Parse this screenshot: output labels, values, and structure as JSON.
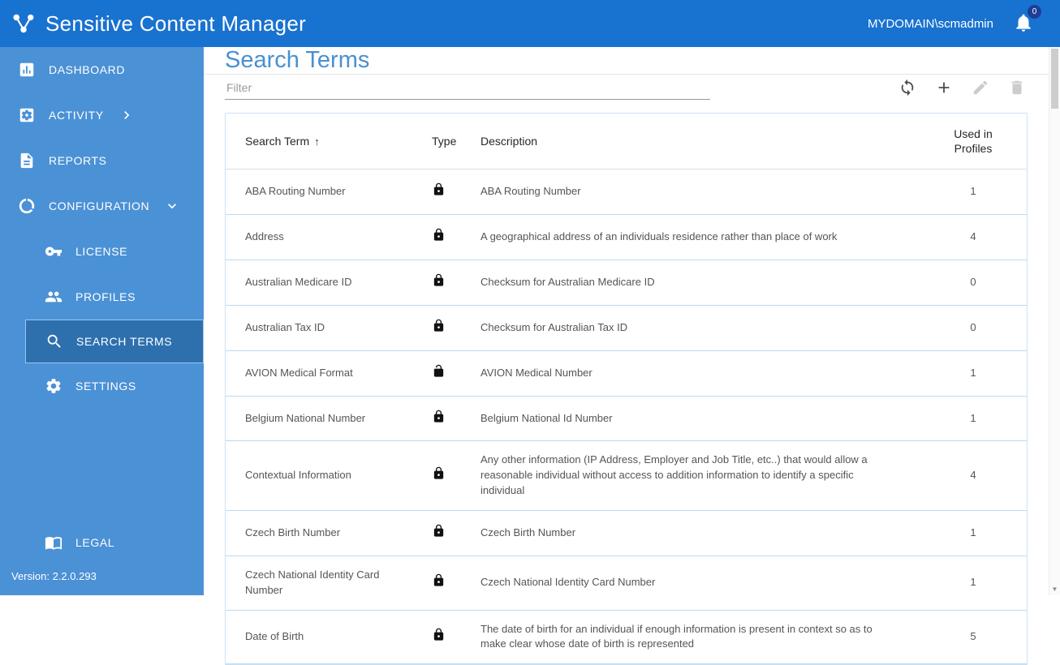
{
  "header": {
    "app_title": "Sensitive Content Manager",
    "username": "MYDOMAIN\\scmadmin",
    "notification_badge": "0"
  },
  "sidebar": {
    "items": [
      {
        "label": "DASHBOARD",
        "icon": "dashboard-icon"
      },
      {
        "label": "ACTIVITY",
        "icon": "activity-icon",
        "chevron": "right"
      },
      {
        "label": "REPORTS",
        "icon": "reports-icon"
      },
      {
        "label": "CONFIGURATION",
        "icon": "configuration-icon",
        "chevron": "down"
      },
      {
        "label": "LICENSE",
        "icon": "license-icon"
      },
      {
        "label": "PROFILES",
        "icon": "profiles-icon"
      },
      {
        "label": "SEARCH TERMS",
        "icon": "search-icon",
        "selected": true
      },
      {
        "label": "SETTINGS",
        "icon": "settings-icon"
      },
      {
        "label": "LEGAL",
        "icon": "legal-icon"
      }
    ],
    "version": "Version: 2.2.0.293"
  },
  "main": {
    "page_title": "Search Terms",
    "filter": {
      "placeholder": "Filter"
    },
    "toolbar": {
      "buttons": [
        {
          "name": "refresh",
          "icon": "refresh-icon",
          "enabled": true
        },
        {
          "name": "add",
          "icon": "add-icon",
          "enabled": true
        },
        {
          "name": "edit",
          "icon": "edit-icon",
          "enabled": false
        },
        {
          "name": "delete",
          "icon": "delete-icon",
          "enabled": false
        }
      ]
    },
    "table": {
      "columns": {
        "term": "Search Term",
        "sort_indicator": "↑",
        "type": "Type",
        "description": "Description",
        "used": "Used in Profiles"
      },
      "rows": [
        {
          "term": "ABA Routing Number",
          "type": "locked",
          "description": "ABA Routing Number",
          "used_in_profiles": "1"
        },
        {
          "term": "Address",
          "type": "locked",
          "description": "A geographical address of an individuals residence rather than place of work",
          "used_in_profiles": "4"
        },
        {
          "term": "Australian Medicare ID",
          "type": "locked",
          "description": "Checksum for Australian Medicare ID",
          "used_in_profiles": "0"
        },
        {
          "term": "Australian Tax ID",
          "type": "locked",
          "description": "Checksum for Australian Tax ID",
          "used_in_profiles": "0"
        },
        {
          "term": "AVION Medical Format",
          "type": "unlocked",
          "description": "AVION Medical Number",
          "used_in_profiles": "1"
        },
        {
          "term": "Belgium National Number",
          "type": "locked",
          "description": "Belgium National Id Number",
          "used_in_profiles": "1"
        },
        {
          "term": "Contextual Information",
          "type": "locked",
          "description": "Any other information (IP Address, Employer and Job Title, etc..) that would allow a reasonable individual without access to addition information to identify a specific individual",
          "used_in_profiles": "4"
        },
        {
          "term": "Czech Birth Number",
          "type": "locked",
          "description": "Czech Birth Number",
          "used_in_profiles": "1"
        },
        {
          "term": "Czech National Identity Card Number",
          "type": "locked",
          "description": "Czech National Identity Card Number",
          "used_in_profiles": "1"
        },
        {
          "term": "Date of Birth",
          "type": "locked",
          "description": "The date of birth for an individual if enough information is present in context so as to make clear whose date of birth is represented",
          "used_in_profiles": "5"
        }
      ]
    }
  }
}
